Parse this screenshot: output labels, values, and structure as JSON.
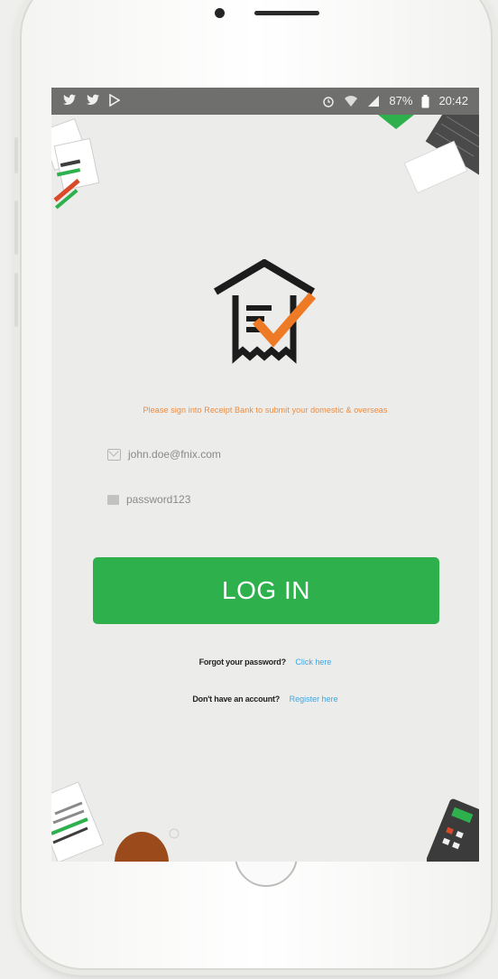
{
  "status_bar": {
    "left_icons": [
      "twitter-icon",
      "twitter-icon",
      "play-icon"
    ],
    "battery": "87%",
    "time": "20:42"
  },
  "app": {
    "tagline": "Please sign into Receipt Bank to submit your domestic & overseas",
    "email": {
      "value": "john.doe@fnix.com",
      "placeholder": "john.doe@fnix.com"
    },
    "password": {
      "value": "password123",
      "placeholder": "password123"
    },
    "login_label": "LOG IN",
    "forgot": {
      "label": "Forgot your password?",
      "link": "Click here"
    },
    "signup": {
      "label": "Don't have an account?",
      "link": "Register here"
    }
  },
  "colors": {
    "accent_green": "#2eb14d",
    "tagline_orange": "#ef8a3c",
    "logo_check": "#ef7a26",
    "link_blue": "#3ea6e4",
    "status_bar": "#6f6f6d"
  }
}
